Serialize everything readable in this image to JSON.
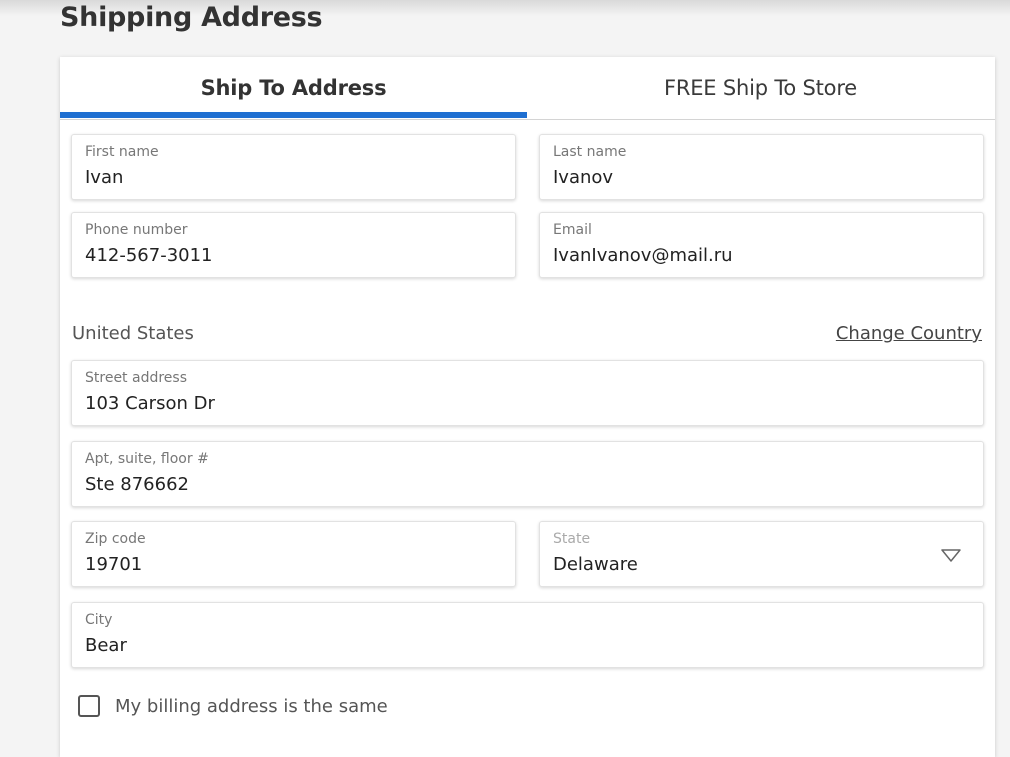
{
  "page": {
    "title": "Shipping Address"
  },
  "tabs": [
    {
      "label": "Ship To Address",
      "active": true
    },
    {
      "label": "FREE Ship To Store",
      "active": false
    }
  ],
  "form": {
    "first_name": {
      "label": "First name",
      "value": "Ivan"
    },
    "last_name": {
      "label": "Last name",
      "value": "Ivanov"
    },
    "phone": {
      "label": "Phone number",
      "value": "412-567-3011"
    },
    "email": {
      "label": "Email",
      "value": "IvanIvanov@mail.ru"
    },
    "country": "United States",
    "change_country": "Change Country",
    "street": {
      "label": "Street address",
      "value": "103 Carson Dr"
    },
    "apt": {
      "label": "Apt, suite, floor #",
      "value": "Ste 876662"
    },
    "zip": {
      "label": "Zip code",
      "value": "19701"
    },
    "state": {
      "label": "State",
      "value": "Delaware",
      "icon": "chevron-down-icon"
    },
    "city": {
      "label": "City",
      "value": "Bear"
    },
    "billing_same": {
      "label": "My billing address is the same",
      "checked": false
    }
  },
  "colors": {
    "accent": "#1f6fd1",
    "background": "#f4f4f4",
    "card": "#ffffff"
  }
}
